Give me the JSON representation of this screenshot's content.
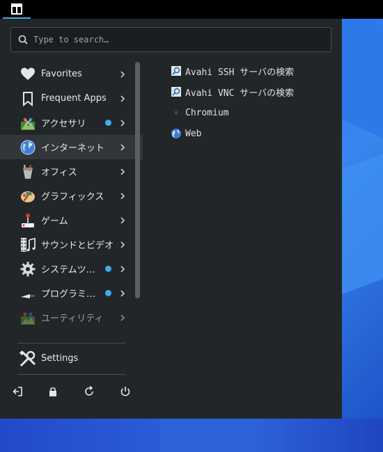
{
  "taskbar": {
    "launcher_icon": "application-menu-icon"
  },
  "search": {
    "placeholder": "Type to search…"
  },
  "categories": [
    {
      "label": "Favorites",
      "icon": "heart-icon",
      "dot": false
    },
    {
      "label": "Frequent Apps",
      "icon": "bookmark-icon",
      "dot": false
    },
    {
      "label": "アクセサリ",
      "icon": "accessories-icon",
      "dot": true
    },
    {
      "label": "インターネット",
      "icon": "globe-icon",
      "dot": false,
      "active": true
    },
    {
      "label": "オフィス",
      "icon": "office-icon",
      "dot": false
    },
    {
      "label": "グラフィックス",
      "icon": "palette-icon",
      "dot": false
    },
    {
      "label": "ゲーム",
      "icon": "joystick-icon",
      "dot": false
    },
    {
      "label": "サウンドとビデオ",
      "icon": "film-music-icon",
      "dot": false
    },
    {
      "label": "システムツ…",
      "icon": "gear-icon",
      "dot": true
    },
    {
      "label": "プログラミ…",
      "icon": "trowel-icon",
      "dot": true
    },
    {
      "label": "ユーティリティ",
      "icon": "utilities-icon",
      "dot": false,
      "dim": true
    }
  ],
  "settings": {
    "label": "Settings",
    "icon": "tools-icon"
  },
  "power": [
    {
      "name": "logout",
      "icon": "logout-icon"
    },
    {
      "name": "lock",
      "icon": "lock-icon"
    },
    {
      "name": "restart",
      "icon": "restart-icon"
    },
    {
      "name": "shutdown",
      "icon": "power-icon"
    }
  ],
  "apps": [
    {
      "label": "Avahi SSH サーバの検索",
      "icon": "network-search-icon"
    },
    {
      "label": "Avahi VNC サーバの検索",
      "icon": "network-search-icon"
    },
    {
      "label": "Chromium",
      "icon": "chromium-icon"
    },
    {
      "label": "Web",
      "icon": "web-browser-icon"
    }
  ],
  "colors": {
    "accent": "#3daee9",
    "menu_bg": "#232629",
    "active_bg": "#31363b"
  }
}
